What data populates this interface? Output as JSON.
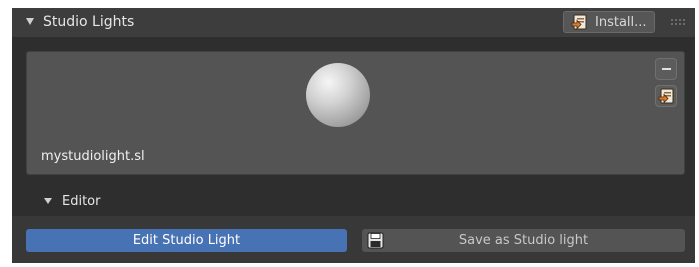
{
  "panel": {
    "title": "Studio Lights",
    "install_label": "Install..."
  },
  "preview": {
    "filename": "mystudiolight.sl"
  },
  "editor": {
    "title": "Editor",
    "edit_label": "Edit Studio Light",
    "save_label": "Save as Studio light"
  },
  "colors": {
    "accent": "#4772b3",
    "panel_bg": "#3d3d3d",
    "preview_bg": "#545454"
  },
  "icons": {
    "collapse": "triangle-down-icon",
    "install": "import-icon",
    "remove": "minus-icon",
    "save": "floppy-disk-icon",
    "drag": "grip-icon"
  }
}
